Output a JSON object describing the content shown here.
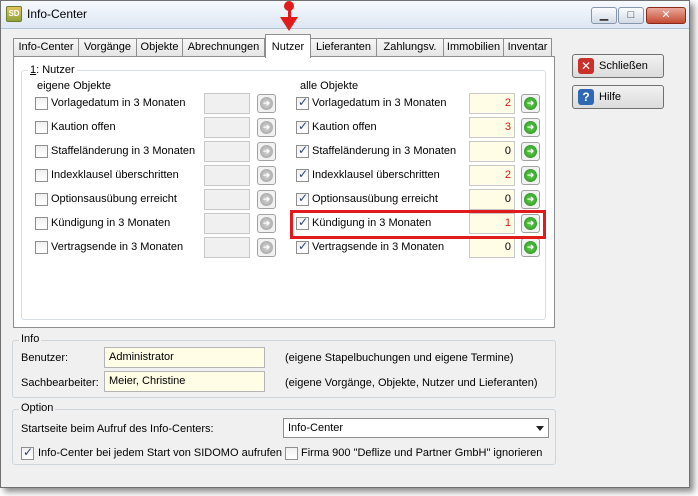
{
  "window": {
    "title": "Info-Center",
    "icon_text": "SD",
    "min_symbol": "▁",
    "max_symbol": "□",
    "close_symbol": "✕"
  },
  "tabs": [
    {
      "label": "Info-Center"
    },
    {
      "label": "Vorgänge"
    },
    {
      "label": "Objekte"
    },
    {
      "label": "Abrechnungen"
    },
    {
      "label": "Nutzer",
      "active": true
    },
    {
      "label": "Lieferanten"
    },
    {
      "label": "Zahlungsv."
    },
    {
      "label": "Immobilien"
    },
    {
      "label": "Inventar"
    }
  ],
  "nutzer": {
    "group_prefix": "1",
    "group_title": ": Nutzer",
    "own_header": "eigene Objekte",
    "all_header": "alle Objekte",
    "own_rows": [
      {
        "label": "Vorlagedatum in 3 Monaten",
        "checked": false,
        "value": ""
      },
      {
        "label": "Kaution offen",
        "checked": false,
        "value": ""
      },
      {
        "label": "Staffeländerung in 3 Monaten",
        "checked": false,
        "value": ""
      },
      {
        "label": "Indexklausel überschritten",
        "checked": false,
        "value": ""
      },
      {
        "label": "Optionsausübung erreicht",
        "checked": false,
        "value": ""
      },
      {
        "label": "Kündigung in 3 Monaten",
        "checked": false,
        "value": ""
      },
      {
        "label": "Vertragsende in 3 Monaten",
        "checked": false,
        "value": ""
      }
    ],
    "all_rows": [
      {
        "label": "Vorlagedatum in 3 Monaten",
        "checked": true,
        "value": "2",
        "red": true
      },
      {
        "label": "Kaution offen",
        "checked": true,
        "value": "3",
        "red": true
      },
      {
        "label": "Staffeländerung in 3 Monaten",
        "checked": true,
        "value": "0",
        "red": false
      },
      {
        "label": "Indexklausel überschritten",
        "checked": true,
        "value": "2",
        "red": true
      },
      {
        "label": "Optionsausübung erreicht",
        "checked": true,
        "value": "0",
        "red": false
      },
      {
        "label": "Kündigung in 3 Monaten",
        "checked": true,
        "value": "1",
        "red": true
      },
      {
        "label": "Vertragsende in 3 Monaten",
        "checked": true,
        "value": "0",
        "red": false
      }
    ]
  },
  "buttons": {
    "close_label": "Schließen",
    "help_label": "Hilfe",
    "go_symbol": "➜"
  },
  "info": {
    "title": "Info",
    "user_label": "Benutzer:",
    "user_value": "Administrator",
    "user_note": "(eigene Stapelbuchungen und eigene Termine)",
    "clerk_label": "Sachbearbeiter:",
    "clerk_value": "Meier, Christine",
    "clerk_note": "(eigene Vorgänge, Objekte, Nutzer und Lieferanten)"
  },
  "option": {
    "title": "Option",
    "start_label": "Startseite beim Aufruf des Info-Centers:",
    "start_value": "Info-Center",
    "open_on_start_label": "Info-Center bei jedem Start von SIDOMO aufrufen",
    "open_on_start_checked": true,
    "ignore_label": "Firma 900 \"Deflize und Partner GmbH\" ignorieren",
    "ignore_checked": false
  },
  "colors": {
    "highlight": "#e11b1b",
    "count_red": "#cc1c12",
    "go_green": "#208f1c"
  }
}
